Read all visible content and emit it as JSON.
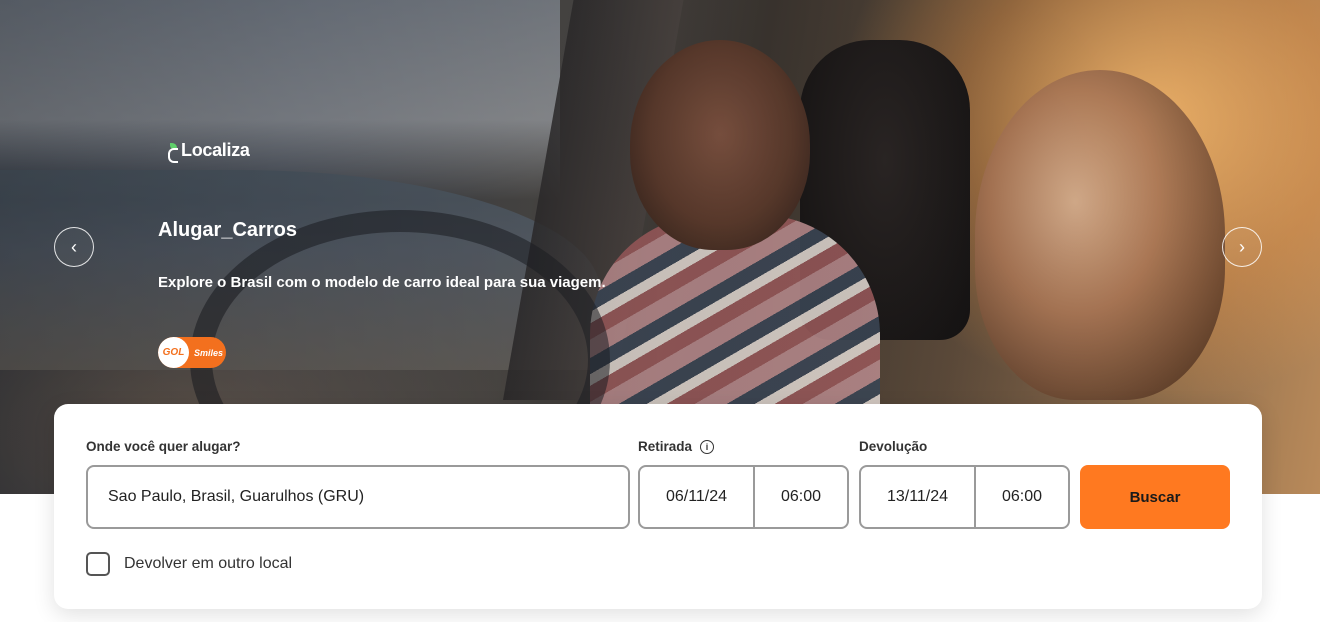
{
  "hero": {
    "brand": "Localiza",
    "title": "Alugar_Carros",
    "subtitle": "Explore o Brasil com o modelo de carro ideal para sua viagem.",
    "partner_primary": "GOL",
    "partner_secondary": "Smiles",
    "prev_icon": "‹",
    "next_icon": "›"
  },
  "search": {
    "location_label": "Onde você quer alugar?",
    "location_value": "Sao Paulo, Brasil, Guarulhos (GRU)",
    "pickup_label": "Retirada",
    "pickup_date": "06/11/24",
    "pickup_time": "06:00",
    "dropoff_label": "Devolução",
    "dropoff_date": "13/11/24",
    "dropoff_time": "06:00",
    "search_button": "Buscar",
    "return_other_label": "Devolver em outro local",
    "return_other_checked": false
  },
  "colors": {
    "accent": "#ff7920",
    "partner_orange": "#f3701e",
    "brand_leaf": "#5fcf6a"
  }
}
